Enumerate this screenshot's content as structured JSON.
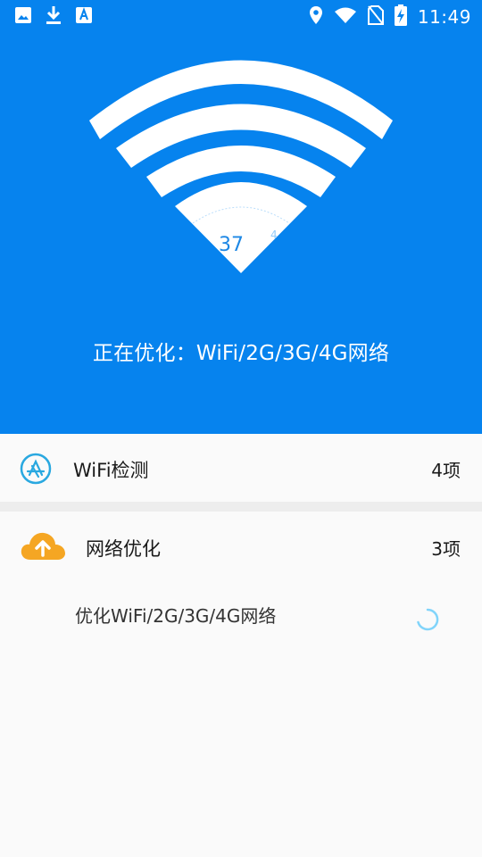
{
  "status_bar": {
    "time": "11:49",
    "left_icons": [
      "image-icon",
      "download-icon",
      "font-a-icon"
    ],
    "right_icons": [
      "location-icon",
      "wifi-icon",
      "no-sim-icon",
      "battery-charging-icon"
    ]
  },
  "hero": {
    "gauge_value": "37",
    "gauge_side_value": "4",
    "status_text": "正在优化：WiFi/2G/3G/4G网络"
  },
  "sections": [
    {
      "icon": "app-store-icon",
      "title": "WiFi检测",
      "count": "4项"
    },
    {
      "icon": "cloud-upload-icon",
      "title": "网络优化",
      "count": "3项"
    }
  ],
  "sub_items": [
    {
      "text": "优化WiFi/2G/3G/4G网络",
      "state_icon": "loading-spinner-icon"
    }
  ],
  "colors": {
    "primary": "#0683ee",
    "accent_icon": "#29a8e0",
    "cloud": "#f5a623",
    "spinner": "#81d4fa"
  }
}
